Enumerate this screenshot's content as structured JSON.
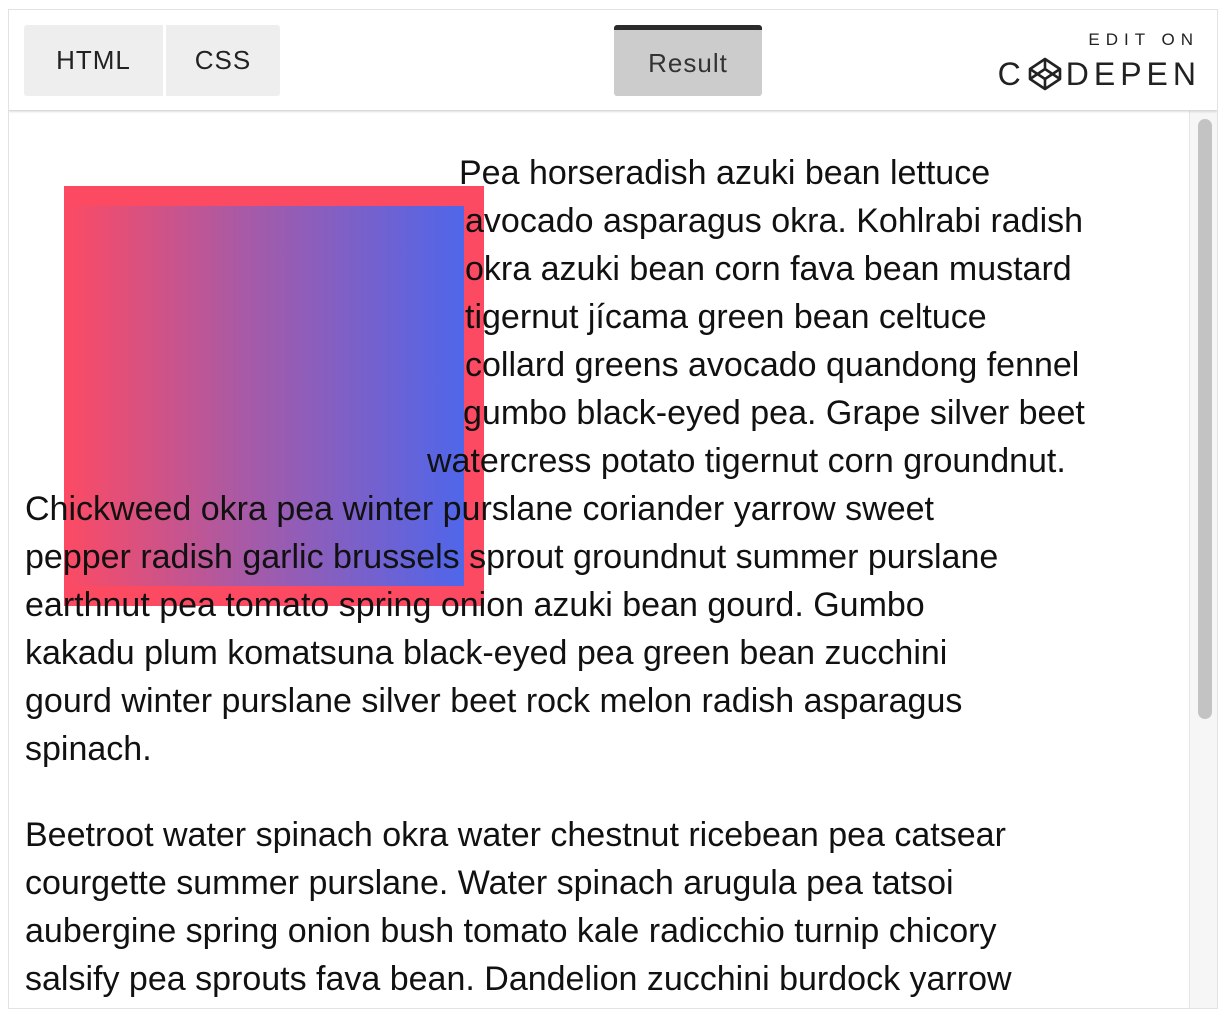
{
  "toolbar": {
    "tabs": {
      "html": "HTML",
      "css": "CSS",
      "result": "Result"
    },
    "brand": {
      "edit_on": "EDIT ON",
      "codepen_pre": "C",
      "codepen_post": "DEPEN"
    }
  },
  "colors": {
    "gradient_start": "#fd4a63",
    "gradient_end": "#4f66ea",
    "tab_active": "#cccccc",
    "tab_inactive": "#eeeeee"
  },
  "result": {
    "paragraph1_lines": [
      "Pea horseradish azuki bean lettuce",
      "avocado asparagus okra. Kohlrabi radish",
      "okra azuki bean corn fava bean mustard",
      "tigernut jícama green bean celtuce",
      "collard greens avocado quandong fennel",
      "gumbo black-eyed pea. Grape silver beet",
      "watercress potato tigernut corn groundnut.",
      "Chickweed okra pea winter purslane coriander yarrow sweet",
      "pepper radish garlic brussels sprout groundnut summer purslane",
      "earthnut pea tomato spring onion azuki bean gourd. Gumbo",
      "kakadu plum komatsuna black-eyed pea green bean zucchini",
      "gourd winter purslane silver beet rock melon radish asparagus",
      "spinach."
    ],
    "paragraph2_lines": [
      "Beetroot water spinach okra water chestnut ricebean pea catsear",
      "courgette summer purslane. Water spinach arugula pea tatsoi",
      "aubergine spring onion bush tomato kale radicchio turnip chicory",
      "salsify pea sprouts fava bean. Dandelion zucchini burdock yarrow"
    ]
  }
}
